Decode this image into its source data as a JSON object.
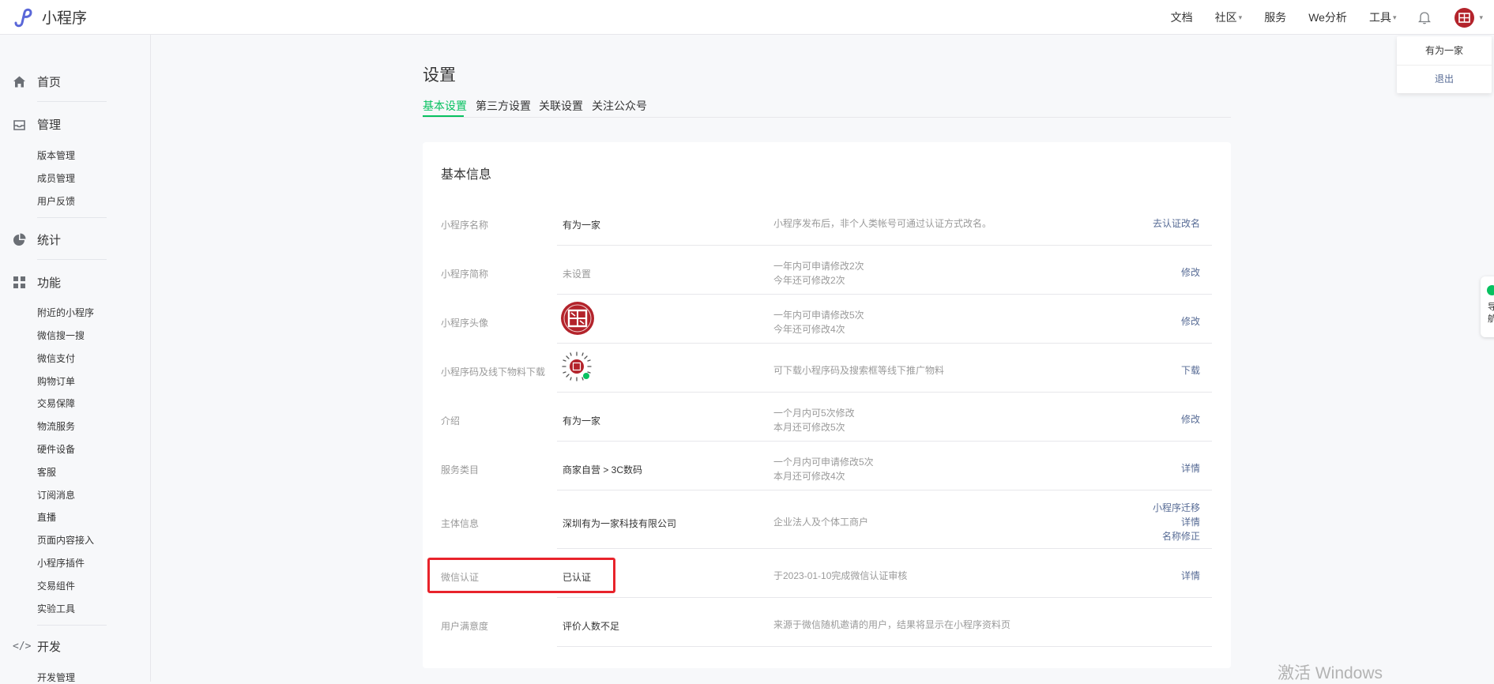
{
  "topbar": {
    "app_name": "小程序",
    "nav": {
      "docs": "文档",
      "community": "社区",
      "services": "服务",
      "we_analytics": "We分析",
      "tools": "工具"
    },
    "user_menu": {
      "username": "有为一家",
      "logout": "退出"
    }
  },
  "sidebar": {
    "home": "首页",
    "manage": {
      "label": "管理",
      "items": [
        "版本管理",
        "成员管理",
        "用户反馈"
      ]
    },
    "stats": "统计",
    "features": {
      "label": "功能",
      "items": [
        "附近的小程序",
        "微信搜一搜",
        "微信支付",
        "购物订单",
        "交易保障",
        "物流服务",
        "硬件设备",
        "客服",
        "订阅消息",
        "直播",
        "页面内容接入",
        "小程序插件",
        "交易组件",
        "实验工具"
      ]
    },
    "dev": {
      "label": "开发",
      "items": [
        "开发管理"
      ]
    }
  },
  "main": {
    "title": "设置",
    "tabs": [
      "基本设置",
      "第三方设置",
      "关联设置",
      "关注公众号"
    ],
    "active_tab": 0,
    "card_title": "基本信息",
    "rows": [
      {
        "label": "小程序名称",
        "value": "有为一家",
        "desc": [
          "小程序发布后，非个人类帐号可通过认证方式改名。"
        ],
        "actions": [
          "去认证改名"
        ]
      },
      {
        "label": "小程序简称",
        "value": "未设置",
        "desc": [
          "一年内可申请修改2次",
          "今年还可修改2次"
        ],
        "actions": [
          "修改"
        ]
      },
      {
        "label": "小程序头像",
        "value": "",
        "desc": [
          "一年内可申请修改5次",
          "今年还可修改4次"
        ],
        "actions": [
          "修改"
        ]
      },
      {
        "label": "小程序码及线下物料下载",
        "value": "",
        "desc": [
          "可下载小程序码及搜索框等线下推广物料"
        ],
        "actions": [
          "下载"
        ]
      },
      {
        "label": "介绍",
        "value": "有为一家",
        "desc": [
          "一个月内可5次修改",
          "本月还可修改5次"
        ],
        "actions": [
          "修改"
        ]
      },
      {
        "label": "服务类目",
        "value": "商家自营 > 3C数码",
        "desc": [
          "一个月内可申请修改5次",
          "本月还可修改4次"
        ],
        "actions": [
          "详情"
        ]
      },
      {
        "label": "主体信息",
        "value": "深圳有为一家科技有限公司",
        "desc": [
          "企业法人及个体工商户"
        ],
        "actions": [
          "小程序迁移",
          "详情",
          "名称修正"
        ]
      },
      {
        "label": "微信认证",
        "value": "已认证",
        "desc": [
          "于2023-01-10完成微信认证审核"
        ],
        "actions": [
          "详情"
        ]
      },
      {
        "label": "用户满意度",
        "value": "评价人数不足",
        "desc": [
          "来源于微信随机邀请的用户，结果将显示在小程序资料页"
        ],
        "actions": []
      }
    ]
  },
  "right_widget": {
    "line1": "导",
    "line2": "航"
  },
  "watermark": "激活 Windows",
  "colors": {
    "accent_green": "#07c160",
    "link_blue": "#576b95",
    "highlight_red": "#e8232b",
    "avatar_red": "#b3232b"
  }
}
